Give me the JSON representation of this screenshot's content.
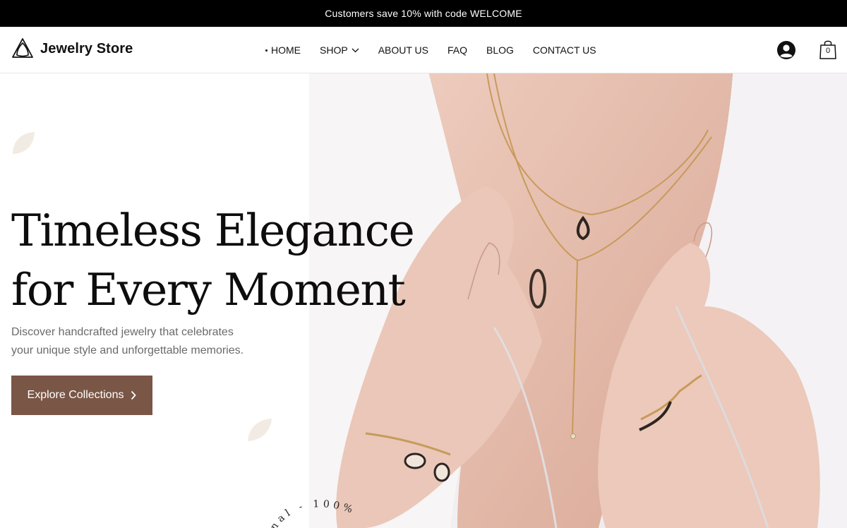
{
  "announcement": {
    "text": "Customers save 10% with code WELCOME"
  },
  "header": {
    "logo_text": "Jewelry Store",
    "nav": [
      {
        "label": "HOME",
        "active": true
      },
      {
        "label": "SHOP",
        "has_dropdown": true
      },
      {
        "label": "ABOUT US"
      },
      {
        "label": "FAQ"
      },
      {
        "label": "BLOG"
      },
      {
        "label": "CONTACT US"
      }
    ],
    "account_icon": "user-circle-icon",
    "cart_icon": "shopping-bag-icon",
    "cart_count": "0"
  },
  "hero": {
    "title_line1": "Timeless Elegance",
    "title_line2": "for Every Moment",
    "subtitle_line1": "Discover handcrafted jewelry that celebrates",
    "subtitle_line2": "your unique style and unforgettable memories.",
    "cta_label": "Explore Collections",
    "cta_color": "#7a5646",
    "seal_text": "nal - 100% "
  },
  "colors": {
    "accent": "#7a5646",
    "announcement_bg": "#000000",
    "leaf": "#f1ebe4"
  }
}
